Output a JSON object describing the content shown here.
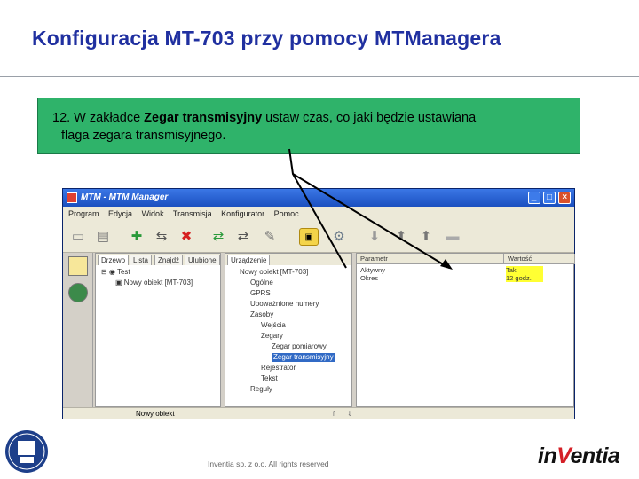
{
  "slide": {
    "title": "Konfiguracja MT-703 przy pomocy MTManagera",
    "footer": "Inventia sp. z o.o. All rights reserved",
    "logo": {
      "prefix": "in",
      "accent": "V",
      "suffix": "entia"
    }
  },
  "callout": {
    "line1_start": "12. W zakładce ",
    "line1_bold": "Zegar transmisyjny",
    "line1_end": " ustaw czas, co jaki będzie ustawiana",
    "line2": "flaga zegara transmisyjnego."
  },
  "app": {
    "title": "MTM - MTM Manager",
    "menu": [
      "Program",
      "Edycja",
      "Widok",
      "Transmisja",
      "Konfigurator",
      "Pomoc"
    ],
    "left_tabs": [
      "Drzewo",
      "Lista",
      "Znajdź",
      "Ulubione"
    ],
    "left_tree": {
      "root": "Test",
      "child": "Nowy obiekt [MT-703]"
    },
    "mid_tab": "Urządzenie",
    "mid_tree": [
      "Nowy obiekt [MT-703]",
      "Ogólne",
      "GPRS",
      "Upoważnione numery",
      "Zasoby",
      "Wejścia",
      "Zegary",
      "Zegar pomiarowy",
      "Zegar transmisyjny",
      "Rejestrator",
      "Tekst",
      "Reguły"
    ],
    "columns": [
      "Parametr",
      "Wartość"
    ],
    "rows": [
      {
        "param": "Aktywny",
        "value": "Tak"
      },
      {
        "param": "Okres",
        "value": "12 godz."
      }
    ],
    "status": "Nowy obiekt"
  },
  "colors": {
    "title": "#2030a0",
    "callout": "#2fb36a",
    "highlight": "#ffff33",
    "logo_red": "#d41f26"
  }
}
